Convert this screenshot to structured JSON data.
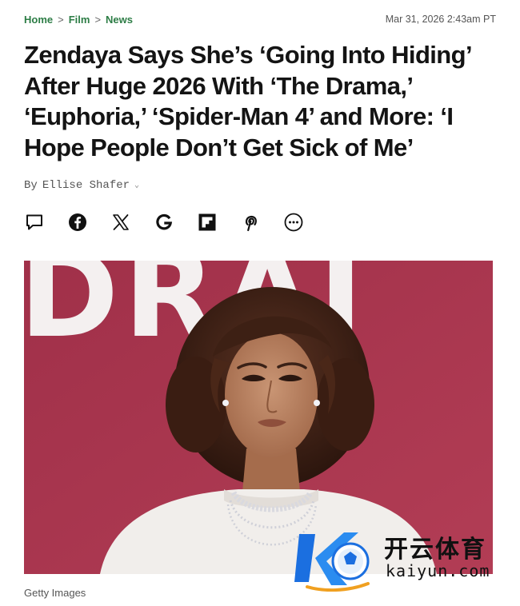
{
  "breadcrumb": {
    "items": [
      "Home",
      "Film",
      "News"
    ],
    "separator": ">"
  },
  "timestamp": "Mar 31, 2026 2:43am PT",
  "headline": "Zendaya Says She’s ‘Going Into Hiding’ After Huge 2026 With ‘The Drama,’ ‘Euphoria,’ ‘Spider-Man 4’ and More: ‘I Hope People Don’t Get Sick of Me’",
  "byline": {
    "prefix": "By",
    "author": "Ellise Shafer",
    "chevron": "⌄"
  },
  "share_icons": [
    "comment-icon",
    "facebook-icon",
    "x-icon",
    "google-icon",
    "flipboard-icon",
    "pinterest-icon",
    "more-icon"
  ],
  "hero_image": {
    "backdrop_text": "DRAI",
    "backdrop_color": "#a8344d"
  },
  "caption": "Getty Images",
  "watermark": {
    "chinese": "开云体育",
    "domain": "kaiyun.com"
  },
  "colors": {
    "breadcrumb": "#2d7d46",
    "headline": "#141414",
    "meta": "#555555"
  }
}
